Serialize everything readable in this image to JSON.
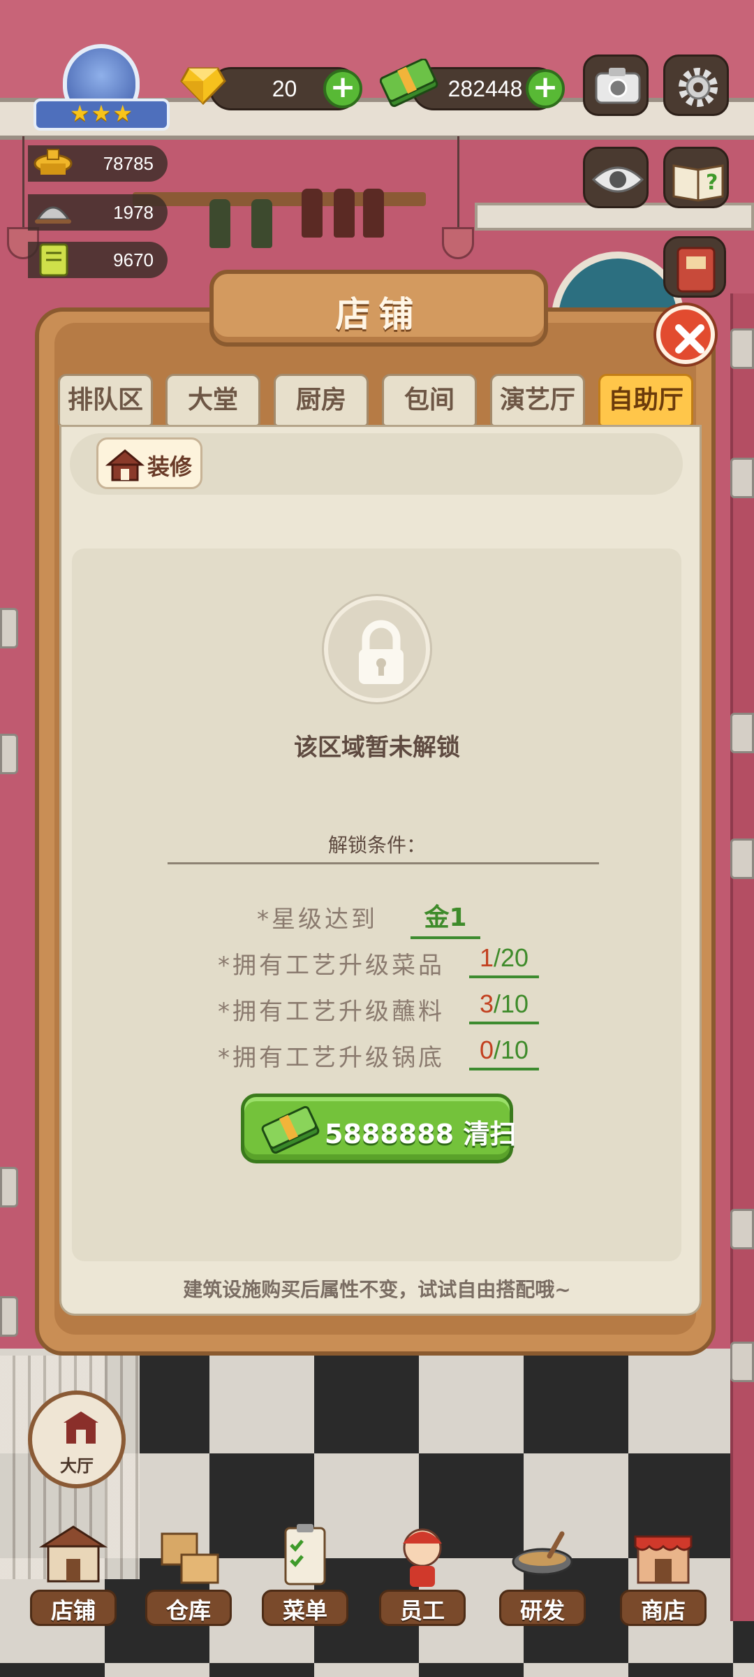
{
  "hud": {
    "gems": "20",
    "cash": "282448",
    "plus": "+",
    "stars": "★★★"
  },
  "resources": [
    {
      "icon": "hot-pot-icon",
      "value": "78785"
    },
    {
      "icon": "serving-tray-icon",
      "value": "1978"
    },
    {
      "icon": "menu-book-icon",
      "value": "9670"
    }
  ],
  "dialog": {
    "title": "店铺",
    "tabs": [
      "排队区",
      "大堂",
      "厨房",
      "包间",
      "演艺厅",
      "自助厅"
    ],
    "active_tab": "自助厅",
    "decorate_label": "装修",
    "locked_text": "该区域暂未解锁",
    "conditions_title": "解锁条件：",
    "requirements": [
      {
        "label": "*星级达到",
        "value": "金1"
      },
      {
        "label": "*拥有工艺升级菜品",
        "have": "1",
        "need": "/20"
      },
      {
        "label": "*拥有工艺升级蘸料",
        "have": "3",
        "need": "/10"
      },
      {
        "label": "*拥有工艺升级锅底",
        "have": "0",
        "need": "/10"
      }
    ],
    "clean_cost": "5888888",
    "clean_label": "清扫",
    "footer_tip": "建筑设施购买后属性不变，试试自由搭配哦~"
  },
  "hall_button": "大厅",
  "bottom_nav": [
    "店铺",
    "仓库",
    "菜单",
    "员工",
    "研发",
    "商店"
  ],
  "colors": {
    "accent_green": "#74c23b",
    "active_tab": "#ffc64a",
    "close_red": "#e24b2f",
    "have_red": "#c2401f",
    "need_green": "#3e8b2a"
  }
}
